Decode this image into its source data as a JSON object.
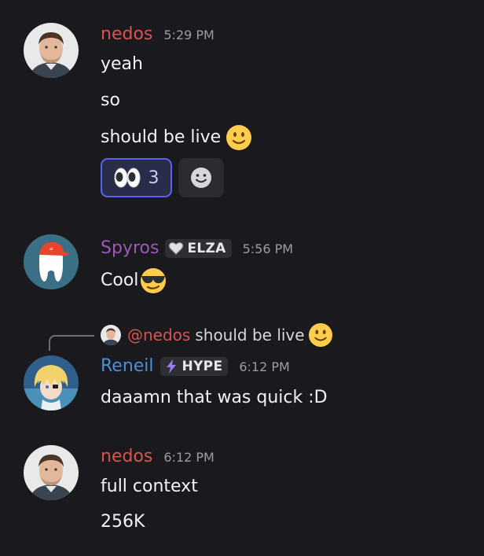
{
  "messages": [
    {
      "username": "nedos",
      "timestamp": "5:29 PM",
      "lines": [
        "yeah",
        "so",
        "should be live"
      ],
      "reactions": [
        {
          "emoji": "eyes",
          "count": "3"
        }
      ]
    },
    {
      "username": "Spyros",
      "tag": "ELZA",
      "timestamp": "5:56 PM",
      "lines": [
        "Cool"
      ]
    },
    {
      "reply_to": {
        "mention": "@nedos",
        "text": "should be live"
      },
      "username": "Reneil",
      "tag": "HYPE",
      "timestamp": "6:12 PM",
      "lines": [
        "daaamn that was quick :D"
      ]
    },
    {
      "username": "nedos",
      "timestamp": "6:12 PM",
      "lines": [
        "full context",
        "256K"
      ]
    }
  ],
  "colors": {
    "background": "#1a1a1e",
    "nedos": "#d9534f",
    "spyros": "#9b59b6",
    "reneil": "#4b8fd6",
    "reaction_accent": "#5865f2"
  }
}
